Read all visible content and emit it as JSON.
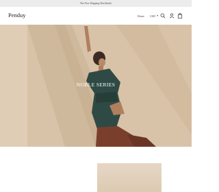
{
  "announcement": {
    "text": "The Free Shipping Worldwide"
  },
  "header": {
    "logo": "Penduy",
    "nav_home": "Home",
    "currency": "USD",
    "icons": [
      "search-icon",
      "user-icon",
      "bag-icon"
    ]
  },
  "hero": {
    "title": "NOBLE SERIES",
    "colors": {
      "wall": "#d6c1a6",
      "shirt": "#2f4a44",
      "pants": "#7a3f2c"
    }
  }
}
